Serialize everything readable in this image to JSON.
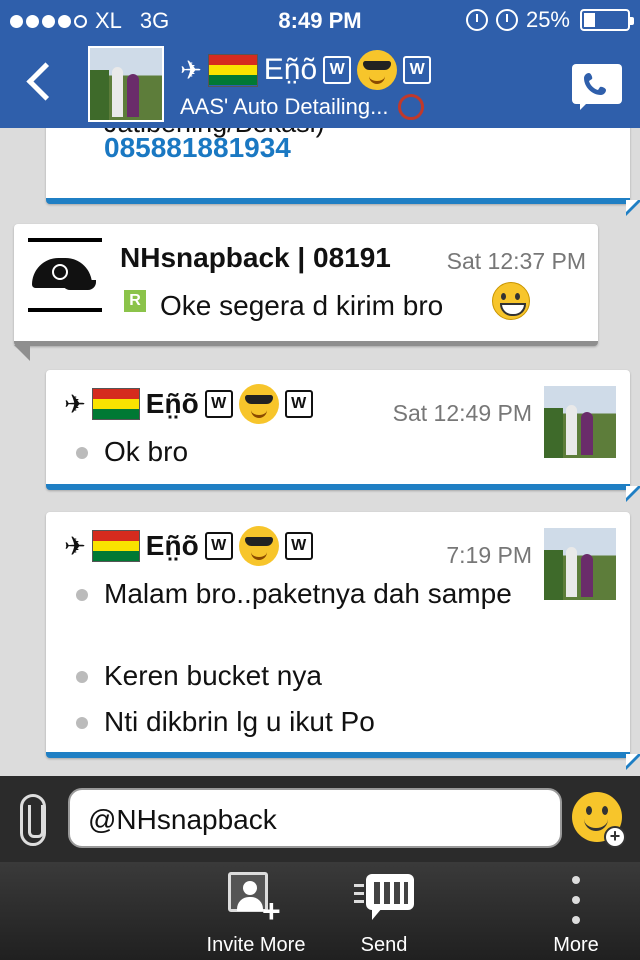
{
  "status": {
    "signal_dots_filled": 4,
    "signal_dots_total": 5,
    "carrier": "XL",
    "network": "3G",
    "time": "8:49 PM",
    "battery": "25%",
    "battery_level": 0.25
  },
  "header": {
    "contact_name": "Eñ̤õ",
    "group_name": "AAS' Auto Detailing...",
    "back_icon": "chevron-left-icon",
    "call_icon": "phone-icon"
  },
  "messages": [
    {
      "partial_text": "Jatibening/Bekasi)",
      "phone": "085881881934"
    },
    {
      "sender": "NHsnapback | 08191",
      "time": "Sat 12:37 PM",
      "badge": "R",
      "text": "Oke segera d kirim bro"
    },
    {
      "sender": "Eñ̤õ",
      "time": "Sat 12:49 PM",
      "lines": [
        "Ok bro"
      ]
    },
    {
      "sender": "Eñ̤õ",
      "time": "7:19 PM",
      "lines": [
        "Malam bro..paketnya dah sampe",
        "Keren bucket nya",
        "Nti dikbrin lg u ikut Po"
      ]
    }
  ],
  "composer": {
    "value": "@NHsnapback"
  },
  "toolbar": {
    "invite": "Invite More",
    "send": "Send",
    "more": "More"
  },
  "colors": {
    "header_blue": "#2f5fab",
    "link_blue": "#1a78c2",
    "outgoing_bar": "#1f7fc4"
  }
}
